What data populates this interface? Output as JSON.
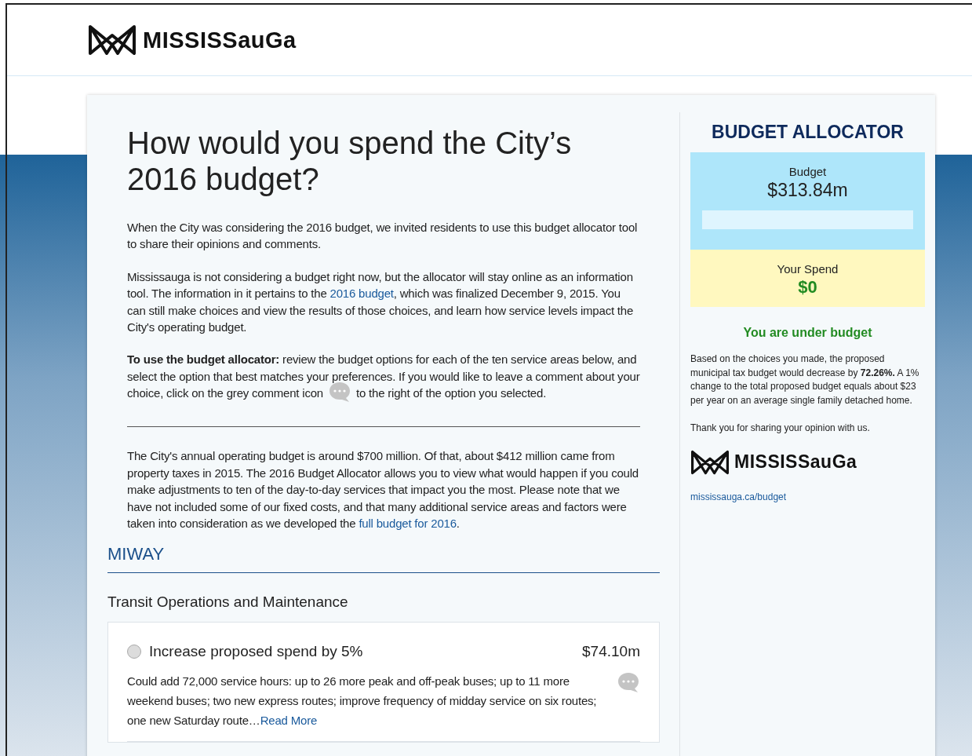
{
  "header": {
    "logo_text": "MISSISSauGa"
  },
  "intro": {
    "title": "How would you spend the City’s 2016 budget?",
    "paragraphs": [
      [
        {
          "kind": "text",
          "text": "When the City was considering the 2016 budget, we invited residents to use this budget allocator tool to share their opinions and comments."
        }
      ],
      [
        {
          "kind": "text",
          "text": "Mississauga is not considering a budget right now, but the allocator will stay online as an information tool. The information in it pertains to the "
        },
        {
          "kind": "link",
          "text": "2016 budget"
        },
        {
          "kind": "text",
          "text": ", which was finalized December 9, 2015. You can still make choices and view the results of those choices, and learn how service levels impact the City's operating budget."
        }
      ],
      [
        {
          "kind": "text",
          "text": "**To use the budget allocator:** review the budget options for each of the ten service areas below, and select the option that best matches your preferences. If you would like to leave a comment about your choice, click on the grey comment icon "
        },
        {
          "kind": "icon"
        },
        {
          "kind": "text",
          "text": " to the right of the option you selected."
        }
      ]
    ],
    "summary": [
      {
        "kind": "text",
        "text": "The City's annual operating budget is around $700 million. Of that, about $412 million came from property taxes in 2015. The 2016 Budget Allocator allows you to view what would happen if you could make adjustments to ten of the day-to-day services that impact you the most. Please note that we have not included some of our fixed costs, and that many additional service areas and factors were taken into consideration as we developed the "
      },
      {
        "kind": "link",
        "text": "full budget for 2016"
      },
      {
        "kind": "text",
        "text": "."
      }
    ]
  },
  "section": {
    "title": "MIWAY",
    "subtitle": "Transit Operations and Maintenance",
    "options": [
      {
        "label": "Increase proposed spend by 5%",
        "amount": "$74.10m",
        "description": "Could add 72,000 service hours: up to 26 more peak and off-peak buses; up to 11 more weekend buses; two new express routes; improve frequency of midday service on six routes; one new Saturday route…",
        "read_more": "Read More",
        "selected": false
      }
    ]
  },
  "sidebar": {
    "title": "BUDGET ALLOCATOR",
    "budget": {
      "label": "Budget",
      "amount": "$313.84m",
      "level": 0
    },
    "spend": {
      "label": "Your Spend",
      "amount": "$0"
    },
    "status": "You are under budget",
    "note": "Based on the choices you made, the proposed municipal tax budget would decrease by **72.26%.**  A 1% change to the total proposed budget equals about $23 per year on an average single family detached home.",
    "thanks": "Thank you for sharing your opinion with us.",
    "logo_text": "MISSISSauGa",
    "link": "mississauga.ca/budget"
  }
}
